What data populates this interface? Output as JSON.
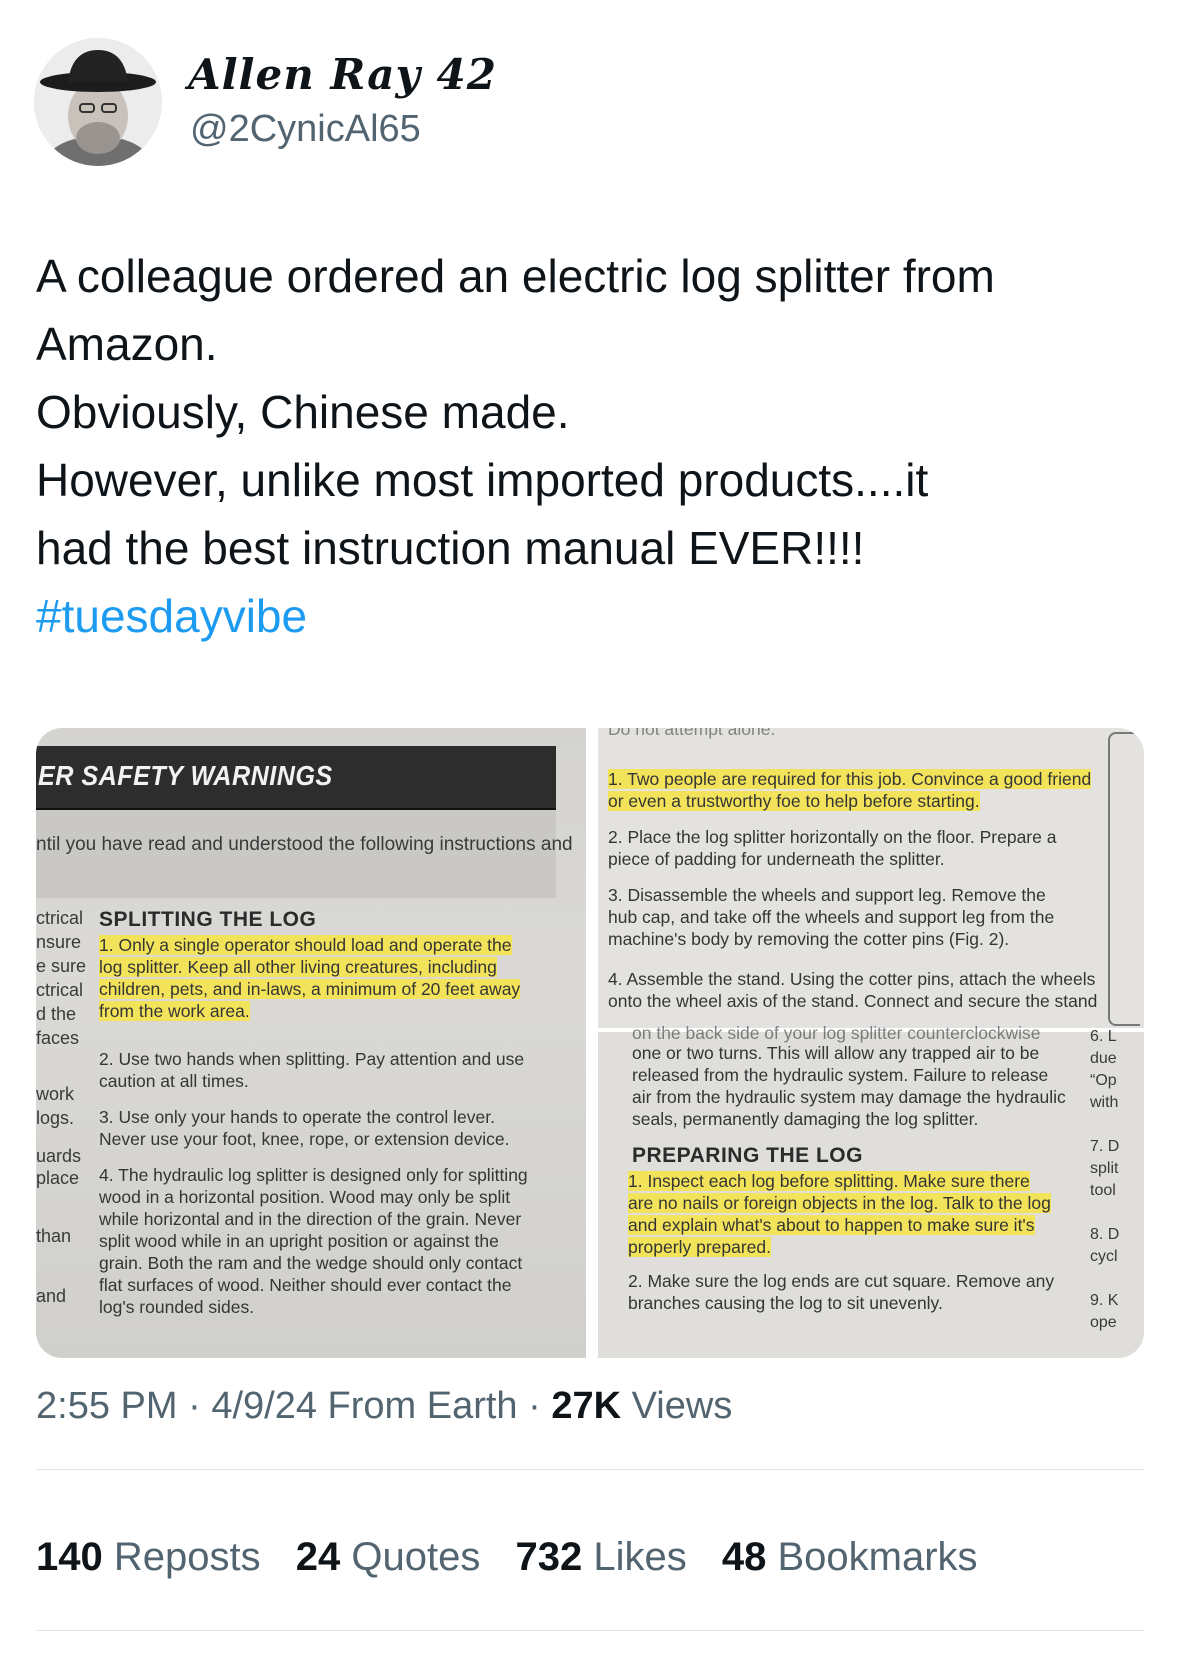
{
  "author": {
    "display_name": "Allen Ray 42",
    "handle": "@2CynicAl65"
  },
  "tweet": {
    "lines": [
      "A colleague ordered an electric log splitter from",
      "Amazon.",
      "Obviously, Chinese made.",
      "However, unlike most imported products....it",
      "had the best instruction manual EVER!!!!"
    ],
    "hashtag": "#tuesdayvibe"
  },
  "media": {
    "left_page": {
      "header": "ER SAFETY WARNINGS",
      "note": "ntil you have read and understood the following instructions and",
      "margin_words": [
        "ctrical",
        "nsure",
        "e sure",
        "ctrical",
        "d the",
        "faces",
        "work",
        "logs.",
        "uards",
        "place",
        "than",
        "and"
      ],
      "section_title": "SPLITTING THE LOG",
      "items": [
        [
          "1. Only a single operator should load and operate the",
          "log splitter. Keep all other living creatures, including",
          "children, pets, and in-laws, a minimum of 20 feet away",
          "from the work area."
        ],
        [
          "2. Use two hands when splitting. Pay attention and use",
          "caution at all times."
        ],
        [
          "3. Use only your hands to operate the control lever.",
          "Never use your foot, knee, rope, or extension device."
        ],
        [
          "4. The hydraulic log splitter is designed only for splitting",
          "wood in a horizontal position. Wood may only be split",
          "while horizontal and in the direction of the grain. Never",
          "split wood while in an upright position or against the",
          "grain. Both the ram and the wedge should only contact",
          "flat surfaces of wood. Neither should ever contact the",
          "log's rounded sides."
        ]
      ]
    },
    "right_page_top": {
      "top_cut": "Do not attempt alone.",
      "items": [
        [
          "1. Two people are required for this job. Convince a good friend",
          "or even a trustworthy foe to help before starting."
        ],
        [
          "2. Place the log splitter horizontally on the floor. Prepare a",
          "piece of padding for underneath the splitter."
        ],
        [
          "3. Disassemble the wheels and support leg. Remove the",
          "hub cap, and take off the wheels and support leg from the",
          "machine's body by removing the cotter pins (Fig. 2)."
        ],
        [
          "4. Assemble the stand. Using the cotter pins, attach the wheels",
          "onto the wheel axis of the stand. Connect and secure the stand"
        ]
      ]
    },
    "right_page_bottom": {
      "cut_line": "on the back side of your log splitter counterclockwise",
      "lines": [
        "one or two turns. This will allow any trapped air to be",
        "released from the hydraulic system. Failure to release",
        "air from the hydraulic system may damage the hydraulic",
        "seals, permanently damaging the log splitter."
      ],
      "section_title": "PREPARING THE LOG",
      "items": [
        [
          "1. Inspect each log before splitting. Make sure there",
          "are no nails or foreign objects in the log. Talk to the log",
          "and explain what's about to happen to make sure it's",
          "properly prepared."
        ],
        [
          "2. Make sure the log ends are cut square. Remove any",
          "branches causing the log to sit unevenly."
        ]
      ],
      "side_words": [
        "6. L",
        "due",
        "“Op",
        "with",
        "",
        "7. D",
        "split",
        "tool",
        "",
        "8. D",
        "cycl",
        "",
        "9. K",
        "ope"
      ]
    }
  },
  "meta": {
    "time": "2:55 PM",
    "separator": " · ",
    "date": "4/9/24",
    "source": "From Earth",
    "views_count": "27K",
    "views_label": "Views"
  },
  "stats": [
    {
      "count": "140",
      "label": "Reposts"
    },
    {
      "count": "24",
      "label": "Quotes"
    },
    {
      "count": "732",
      "label": "Likes"
    },
    {
      "count": "48",
      "label": "Bookmarks"
    }
  ]
}
